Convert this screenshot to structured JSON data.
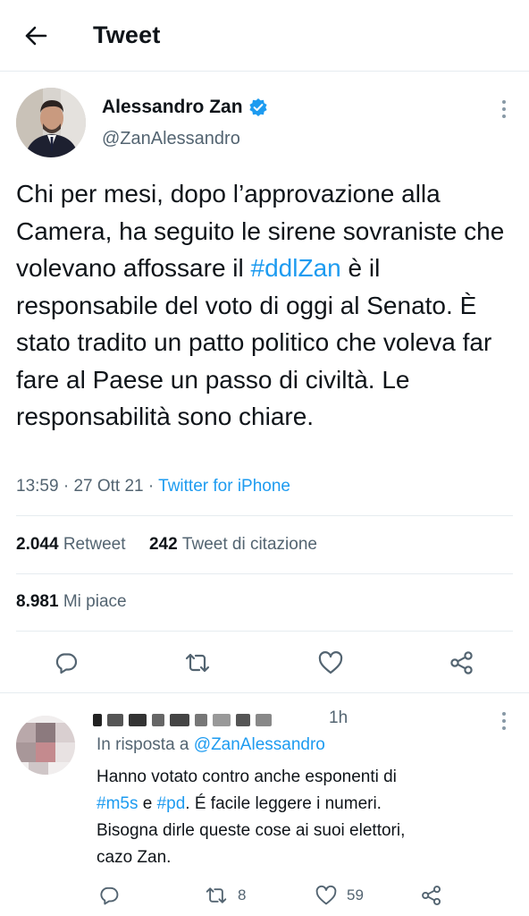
{
  "header": {
    "title": "Tweet"
  },
  "tweet": {
    "author_name": "Alessandro Zan",
    "author_handle": "@ZanAlessandro",
    "text_before": "Chi per mesi, dopo l’approvazione alla Camera, ha seguito le sirene sovraniste che volevano affossare il ",
    "hashtag": "#ddlZan",
    "text_after": " è il responsabile del voto di oggi al Senato. È stato tradito un patto politico che voleva far fare al Paese un passo di civiltà. Le responsabilità sono chiare.",
    "time": "13:59",
    "date": "27 Ott 21",
    "source": "Twitter for iPhone"
  },
  "stats": {
    "retweets_count": "2.044",
    "retweets_label": "Retweet",
    "quotes_count": "242",
    "quotes_label": "Tweet di citazione",
    "likes_count": "8.981",
    "likes_label": "Mi piace"
  },
  "reply": {
    "time": "1h",
    "reply_to_label": "In risposta a",
    "reply_to_handle": "@ZanAlessandro",
    "text_line1": "Hanno votato contro anche esponenti di",
    "hashtag1": "#m5s",
    "conj": " e ",
    "hashtag2": "#pd",
    "text_line2_after": ". É facile leggere i numeri.",
    "text_line3": "Bisogna dirle queste cose ai suoi elettori,",
    "text_line4": "cazo Zan.",
    "retweet_count": "8",
    "like_count": "59"
  },
  "colors": {
    "accent": "#1d9bf0",
    "text": "#0f1419",
    "muted": "#536471",
    "border": "#e6ecf0"
  },
  "icons": [
    "back-arrow-icon",
    "verified-badge-icon",
    "more-options-icon",
    "reply-icon",
    "retweet-icon",
    "like-icon",
    "share-icon"
  ]
}
